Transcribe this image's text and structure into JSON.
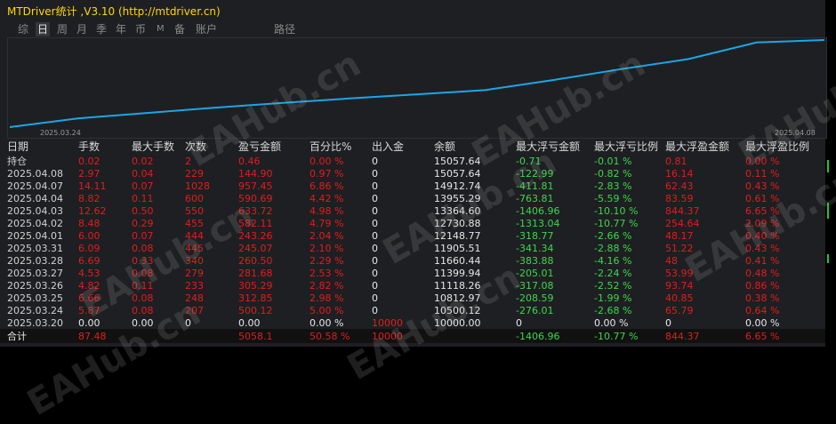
{
  "window": {
    "title": "MTDriver统计 ,V3.10 (http://mtdriver.cn)"
  },
  "tabs": [
    {
      "label": "综",
      "active": false
    },
    {
      "label": "日",
      "active": true
    },
    {
      "label": "周",
      "active": false
    },
    {
      "label": "月",
      "active": false
    },
    {
      "label": "季",
      "active": false
    },
    {
      "label": "年",
      "active": false
    },
    {
      "label": "币",
      "active": false
    },
    {
      "label": "M",
      "active": false
    },
    {
      "label": "备",
      "active": false
    },
    {
      "label": "账户",
      "active": false
    },
    {
      "label": "路径",
      "active": false
    }
  ],
  "chart_data": {
    "type": "line",
    "x": [
      "2025.03.20",
      "2025.03.24",
      "2025.03.25",
      "2025.03.26",
      "2025.03.27",
      "2025.03.28",
      "2025.03.31",
      "2025.04.01",
      "2025.04.02",
      "2025.04.03",
      "2025.04.04",
      "2025.04.07",
      "2025.04.08"
    ],
    "series": [
      {
        "values": [
          10000.0,
          10500.12,
          10812.97,
          11118.26,
          11399.94,
          11660.44,
          11905.51,
          12148.77,
          12730.88,
          13364.6,
          13955.29,
          14912.74,
          15057.64
        ]
      }
    ],
    "x_tick_labels": [
      "2025.03.24",
      "2025.04.08"
    ],
    "line_color": "#1aa7e6",
    "grid": false
  },
  "table": {
    "headers": [
      "日期",
      "手数",
      "最大手数",
      "次数",
      "盈亏金额",
      "百分比%",
      "出入金",
      "余额",
      "最大浮亏金额",
      "最大浮亏比例",
      "最大浮盈金额",
      "最大浮盈比例"
    ],
    "rows": [
      [
        "持仓",
        "0.02",
        "0.02",
        "2",
        "0.46",
        "0.00 %",
        "0",
        "15057.64",
        "-0.71",
        "-0.01 %",
        "0.81",
        "0.00 %"
      ],
      [
        "2025.04.08",
        "2.97",
        "0.04",
        "229",
        "144.90",
        "0.97 %",
        "0",
        "15057.64",
        "-122.99",
        "-0.82 %",
        "16.14",
        "0.11 %"
      ],
      [
        "2025.04.07",
        "14.11",
        "0.07",
        "1028",
        "957.45",
        "6.86 %",
        "0",
        "14912.74",
        "-411.81",
        "-2.83 %",
        "62.43",
        "0.43 %"
      ],
      [
        "2025.04.04",
        "8.82",
        "0.11",
        "600",
        "590.69",
        "4.42 %",
        "0",
        "13955.29",
        "-763.81",
        "-5.59 %",
        "83.59",
        "0.61 %"
      ],
      [
        "2025.04.03",
        "12.62",
        "0.50",
        "550",
        "633.72",
        "4.98 %",
        "0",
        "13364.60",
        "-1406.96",
        "-10.10 %",
        "844.37",
        "6.65 %"
      ],
      [
        "2025.04.02",
        "8.48",
        "0.29",
        "455",
        "582.11",
        "4.79 %",
        "0",
        "12730.88",
        "-1313.04",
        "-10.77 %",
        "254.64",
        "2.09 %"
      ],
      [
        "2025.04.01",
        "6.00",
        "0.07",
        "444",
        "243.26",
        "2.04 %",
        "0",
        "12148.77",
        "-318.77",
        "-2.66 %",
        "48.17",
        "0.40 %"
      ],
      [
        "2025.03.31",
        "6.09",
        "0.08",
        "445",
        "245.07",
        "2.10 %",
        "0",
        "11905.51",
        "-341.34",
        "-2.88 %",
        "51.22",
        "0.43 %"
      ],
      [
        "2025.03.28",
        "6.69",
        "0.33",
        "340",
        "260.50",
        "2.29 %",
        "0",
        "11660.44",
        "-383.88",
        "-4.16 %",
        "48",
        "0.41 %"
      ],
      [
        "2025.03.27",
        "4.53",
        "0.08",
        "279",
        "281.68",
        "2.53 %",
        "0",
        "11399.94",
        "-205.01",
        "-2.24 %",
        "53.99",
        "0.48 %"
      ],
      [
        "2025.03.26",
        "4.82",
        "0.11",
        "233",
        "305.29",
        "2.82 %",
        "0",
        "11118.26",
        "-317.08",
        "-2.52 %",
        "93.74",
        "0.86 %"
      ],
      [
        "2025.03.25",
        "6.66",
        "0.08",
        "248",
        "312.85",
        "2.98 %",
        "0",
        "10812.97",
        "-208.59",
        "-1.99 %",
        "40.85",
        "0.38 %"
      ],
      [
        "2025.03.24",
        "5.87",
        "0.08",
        "207",
        "500.12",
        "5.00 %",
        "0",
        "10500.12",
        "-276.01",
        "-2.68 %",
        "65.79",
        "0.64 %"
      ],
      [
        "2025.03.20",
        "0.00",
        "0.00",
        "0",
        "0.00",
        "0.00 %",
        "10000",
        "10000.00",
        "0",
        "0.00 %",
        "0",
        "0.00 %"
      ]
    ],
    "summary": [
      "合计",
      "87.48",
      "",
      "",
      "5058.1",
      "50.58 %",
      "10000",
      "",
      "-1406.96",
      "-10.77 %",
      "844.37",
      "6.65 %"
    ]
  },
  "watermark": "EAHub.cn",
  "colors": {
    "positive": "#e11d1d",
    "negative": "#3bd74a",
    "title": "#ffd700"
  }
}
